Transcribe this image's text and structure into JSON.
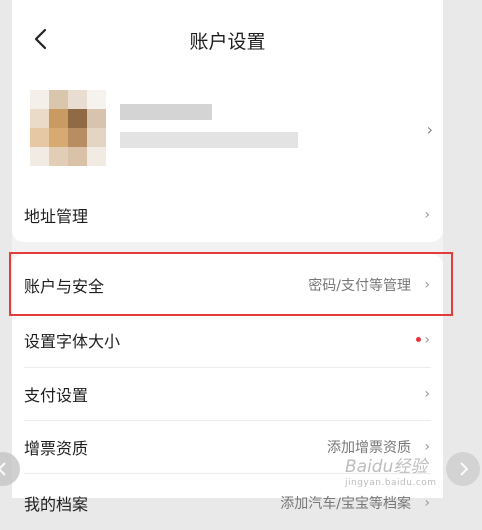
{
  "header": {
    "title": "账户设置",
    "back_icon": "chevron-left-icon"
  },
  "profile": {
    "chevron": "›"
  },
  "address": {
    "label": "地址管理",
    "chevron": "›"
  },
  "list": [
    {
      "label": "账户与安全",
      "value": "密码/支付等管理",
      "chevron": "›"
    },
    {
      "label": "设置字体大小",
      "value": "",
      "chevron": "›",
      "dot_color": "#e8323e"
    },
    {
      "label": "支付设置",
      "value": "",
      "chevron": "›"
    },
    {
      "label": "增票资质",
      "value": "添加增票资质",
      "chevron": "›"
    },
    {
      "label": "我的档案",
      "value": "添加汽车/宝宝等档案",
      "chevron": "›"
    }
  ],
  "watermark": {
    "brand": "Baidu经验",
    "sub": "jingyan.baidu.com"
  },
  "colors": {
    "highlight": "#e23c3c",
    "accent_dot": "#e8323e"
  }
}
